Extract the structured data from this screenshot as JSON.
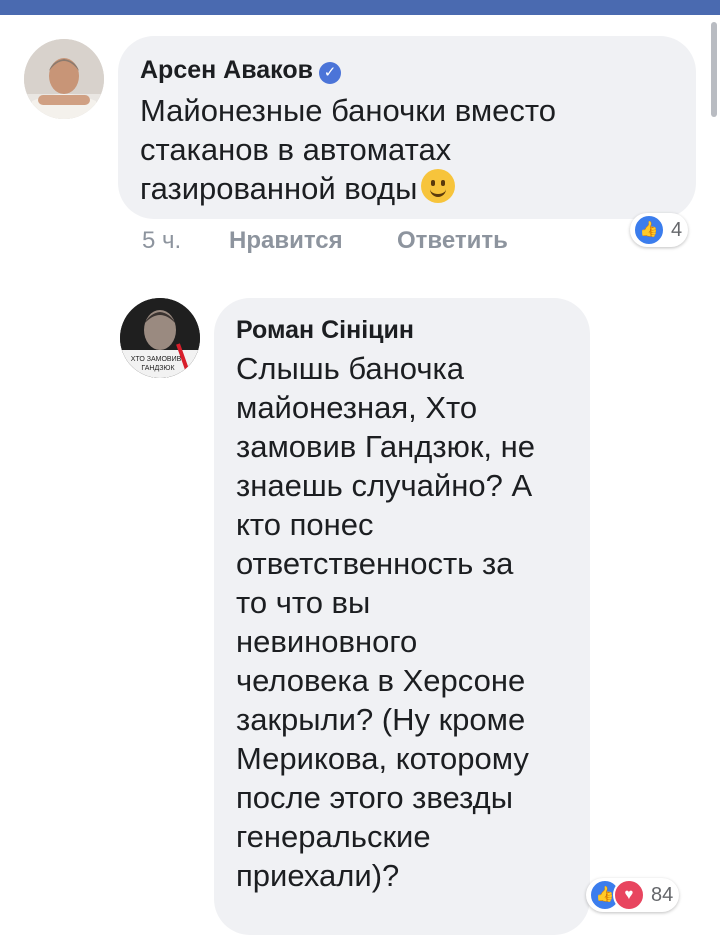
{
  "comments": [
    {
      "author": "Арсен Аваков",
      "verified": true,
      "text": "Майонезные баночки вместо\nстаканов в автоматах\nгазированной воды",
      "emoji": "slightly-smiling-face",
      "time": "5 ч.",
      "like_label": "Нравится",
      "reply_label": "Ответить",
      "reactions": {
        "types": [
          "like"
        ],
        "count": "4"
      }
    },
    {
      "author": "Роман Сініцин",
      "verified": false,
      "avatar_caption": "ХТО ЗАМОВИВ ГАНДЗЮК",
      "text": "Слышь баночка\nмайонезная, Хто\nзамовив Гандзюк, не\nзнаешь случайно? А\nкто понес\nответственность за\nто что вы\nневиновного\nчеловека в Херсоне\nзакрыли? (Ну кроме\nМерикова, которому\nпосле этого звезды\nгенеральские\nприехали)?",
      "reactions": {
        "types": [
          "like",
          "love"
        ],
        "count": "84"
      }
    }
  ],
  "colors": {
    "top_bar": "#4a6ab0",
    "bubble": "#f0f1f4",
    "meta_text": "#8d949e",
    "like_reaction": "#3b7ded",
    "love_reaction": "#e8455f",
    "verified_badge": "#4b74d8"
  }
}
